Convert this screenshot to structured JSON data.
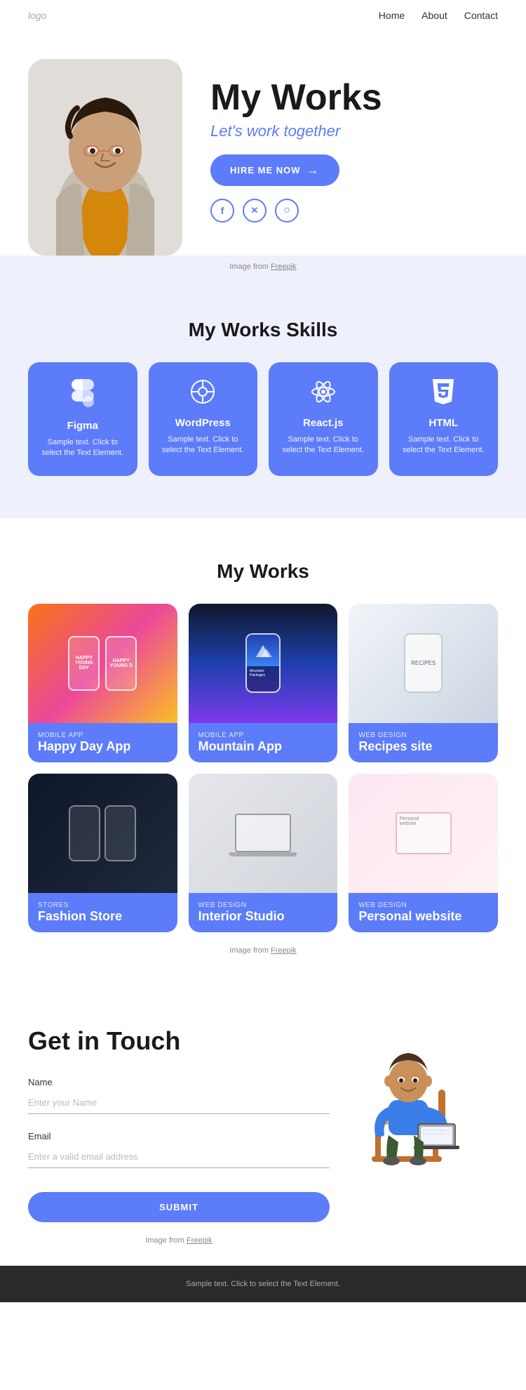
{
  "nav": {
    "logo": "logo",
    "links": [
      "Home",
      "About",
      "Contact"
    ]
  },
  "hero": {
    "title": "My Works",
    "subtitle": "Let's work together",
    "hire_btn": "HIRE ME NOW",
    "image_credit": "Image from Freepik",
    "social": [
      {
        "name": "Facebook",
        "symbol": "f"
      },
      {
        "name": "Twitter/X",
        "symbol": "𝕏"
      },
      {
        "name": "Instagram",
        "symbol": "📷"
      }
    ]
  },
  "skills": {
    "section_title": "My Works Skills",
    "cards": [
      {
        "icon": "✦",
        "name": "Figma",
        "desc": "Sample text. Click to select the Text Element."
      },
      {
        "icon": "⊕",
        "name": "WordPress",
        "desc": "Sample text. Click to select the Text Element."
      },
      {
        "icon": "⚛",
        "name": "React.js",
        "desc": "Sample text. Click to select the Text Element."
      },
      {
        "icon": "◧",
        "name": "HTML",
        "desc": "Sample text. Click to select the Text Element."
      }
    ]
  },
  "works": {
    "section_title": "My Works",
    "image_credit": "Image from Freepik",
    "cards": [
      {
        "category": "MOBILE APP",
        "name": "Happy Day App",
        "visual": "happy"
      },
      {
        "category": "MOBILE APP",
        "name": "Mountain App",
        "visual": "mountain"
      },
      {
        "category": "WEB DESIGN",
        "name": "Recipes site",
        "visual": "recipes"
      },
      {
        "category": "STORES",
        "name": "Fashion Store",
        "visual": "fashion"
      },
      {
        "category": "WEB DESIGN",
        "name": "Interior Studio",
        "visual": "interior"
      },
      {
        "category": "WEB DESIGN",
        "name": "Personal website",
        "visual": "personal"
      }
    ]
  },
  "contact": {
    "title": "Get in Touch",
    "name_label": "Name",
    "name_placeholder": "Enter your Name",
    "email_label": "Email",
    "email_placeholder": "Enter a valid email address",
    "submit_label": "SUBMIT",
    "image_credit": "Image from Freepik"
  },
  "footer": {
    "text": "Sample text. Click to select the Text Element."
  }
}
